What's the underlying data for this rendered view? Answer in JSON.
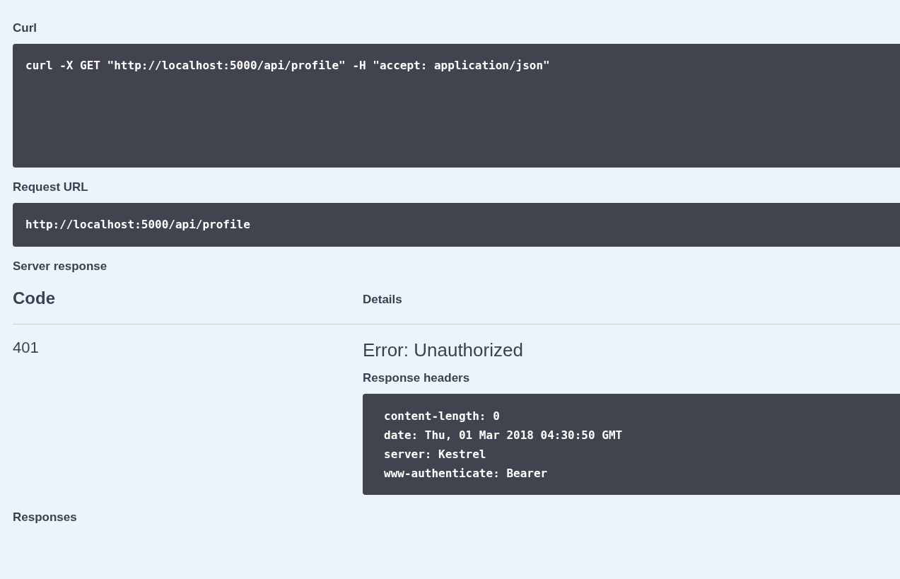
{
  "blocks": [
    {
      "title": "Curl",
      "code": "curl -X GET \"http://localhost:5000/api/profile\" -H \"accept: application/json\"",
      "tall": true
    },
    {
      "title": "Request URL",
      "code": "http://localhost:5000/api/profile",
      "tall": false
    }
  ],
  "server_response": {
    "title": "Server response",
    "columns": [
      "Code",
      "Details"
    ],
    "rows": [
      {
        "code": "401",
        "status": "Error: Unauthorized",
        "headers_title": "Response headers",
        "headers": [
          "content-length: 0",
          "date: Thu, 01 Mar 2018 04:30:50 GMT",
          "server: Kestrel",
          "www-authenticate: Bearer"
        ]
      }
    ]
  },
  "responses": {
    "title": "Responses"
  }
}
